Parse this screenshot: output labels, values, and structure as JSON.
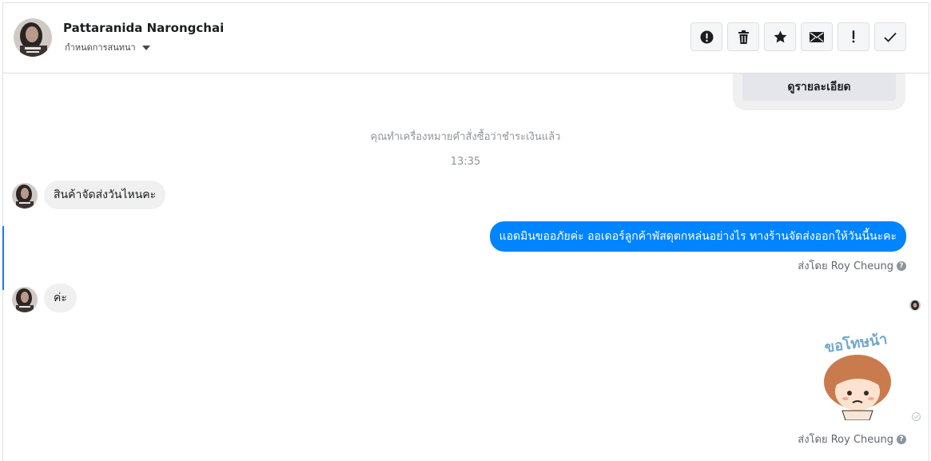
{
  "header": {
    "contact_name": "Pattaranida Narongchai",
    "subtitle": "กำหนดการสนทนา",
    "toolbar_icons": [
      "alert-circle-icon",
      "trash-icon",
      "star-icon",
      "envelope-icon",
      "exclamation-icon",
      "checkmark-icon"
    ]
  },
  "card": {
    "button_label": "ดูรายละเอียด"
  },
  "conversation": {
    "system_note": "คุณทำเครื่องหมายคำสั่งซื้อว่าชำระเงินแล้ว",
    "time_1": "13:35",
    "msg_1": "สินค้าจัดส่งวันไหนคะ",
    "msg_2": "แอดมินขออภัยค่ะ ออเดอร์ลูกค้าพัสดุตกหล่นอย่างไร ทางร้านจัดส่งออกให้วันนี้นะคะ",
    "sent_by_1": "ส่งโดย Roy Cheung",
    "msg_3": "ค่ะ",
    "sticker_text": "ขอโทษน้า",
    "sent_by_2": "ส่งโดย Roy Cheung"
  },
  "colors": {
    "accent": "#0084ff",
    "bubble_in": "#f1f0f0",
    "meta_text": "#90949c"
  }
}
